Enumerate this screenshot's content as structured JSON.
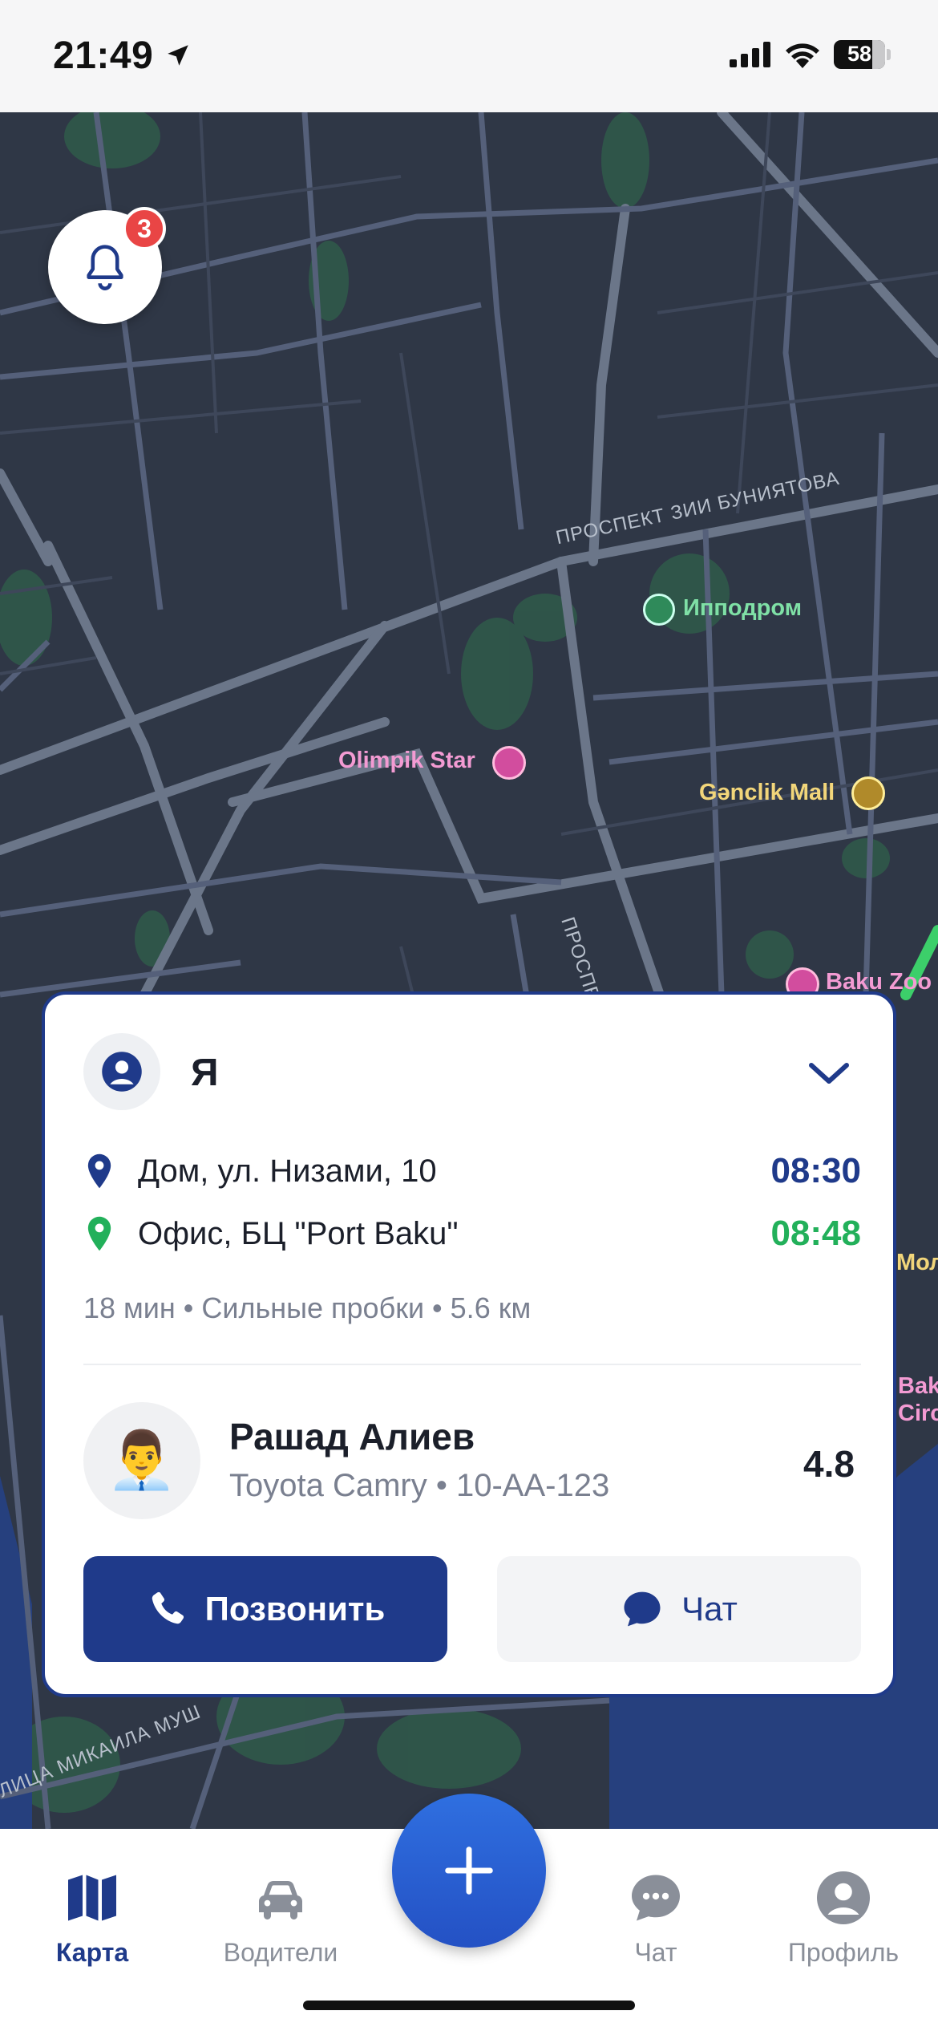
{
  "status_bar": {
    "time": "21:49",
    "battery": "58"
  },
  "notifications": {
    "badge_count": "3"
  },
  "map": {
    "labels": {
      "street1": "ПРОСПЕКТ ЗИИ БУНИЯТОВА",
      "street2": "ПРОСПЕКТ АЗАДЛ",
      "street3": "ЛИЦА МИКАИЛА МУШ",
      "poi_hippodrome": "Ипподром",
      "poi_olimpik": "Olimpik Star",
      "poi_genclik": "Gənclik Mall",
      "poi_zoo": "Baku Zoo",
      "edge1": "Мол",
      "edge2": "Bak",
      "edge3": "Circ"
    }
  },
  "trip_card": {
    "passenger_name": "Я",
    "from": {
      "address": "Дом, ул. Низами, 10",
      "time": "08:30"
    },
    "to": {
      "address": "Офис, БЦ \"Port Baku\"",
      "time": "08:48"
    },
    "meta": "18 мин • Сильные пробки • 5.6 км",
    "driver": {
      "name": "Рашад Алиев",
      "car": "Toyota Camry • 10-AA-123",
      "rating": "4.8",
      "avatar": "👨‍💼"
    },
    "call_label": "Позвонить",
    "chat_label": "Чат"
  },
  "tabbar": {
    "items": [
      {
        "label": "Карта",
        "icon": "map-icon",
        "active": true
      },
      {
        "label": "Водители",
        "icon": "car-icon",
        "active": false
      },
      {
        "label": "Чат",
        "icon": "chat-bubble-icon",
        "active": false
      },
      {
        "label": "Профиль",
        "icon": "profile-icon",
        "active": false
      }
    ]
  },
  "colors": {
    "primary": "#1f3a8a",
    "accent_green": "#22b05a",
    "badge_red": "#e94545",
    "map_bg": "#2f3746"
  }
}
